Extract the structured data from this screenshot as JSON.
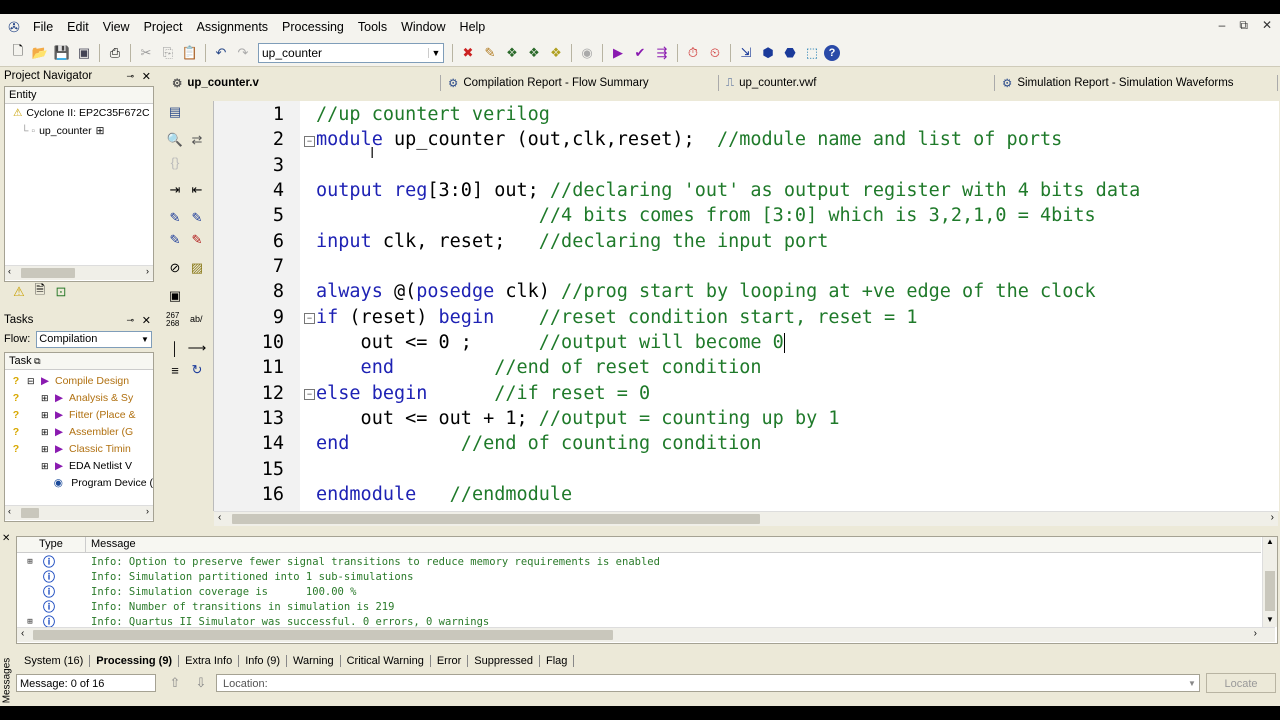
{
  "menu": [
    "File",
    "Edit",
    "View",
    "Project",
    "Assignments",
    "Processing",
    "Tools",
    "Window",
    "Help"
  ],
  "toolbar": {
    "project_combo": "up_counter"
  },
  "project_navigator": {
    "title": "Project Navigator",
    "column": "Entity",
    "device": "Cyclone II: EP2C35F672C",
    "top_entity": "up_counter"
  },
  "tasks": {
    "title": "Tasks",
    "flow_label": "Flow:",
    "flow_value": "Compilation",
    "column": "Task",
    "items": [
      "Compile Design",
      "Analysis & Sy",
      "Fitter (Place &",
      "Assembler (G",
      "Classic Timin",
      "EDA Netlist V",
      "Program Device ("
    ]
  },
  "tabs": [
    "up_counter.v",
    "Compilation Report - Flow Summary",
    "up_counter.vwf",
    "Simulation Report - Simulation Waveforms"
  ],
  "editor": {
    "line_numbers": [
      "1",
      "2",
      "3",
      "4",
      "5",
      "6",
      "7",
      "8",
      "9",
      "10",
      "11",
      "12",
      "13",
      "14",
      "15",
      "16"
    ]
  },
  "messages": {
    "col_type": "Type",
    "col_message": "Message",
    "rows": [
      "Info: Option to preserve fewer signal transitions to reduce memory requirements is enabled",
      "Info: Simulation partitioned into 1 sub-simulations",
      "Info: Simulation coverage is      100.00 %",
      "Info: Number of transitions in simulation is 219",
      "Info: Quartus II Simulator was successful. 0 errors, 0 warnings"
    ],
    "tabs": [
      "System (16)",
      "Processing (9)",
      "Extra Info",
      "Info (9)",
      "Warning",
      "Critical Warning",
      "Error",
      "Suppressed",
      "Flag"
    ],
    "side_label": "Messages",
    "status": "Message: 0 of 16",
    "location_label": "Location:",
    "locate_button": "Locate"
  },
  "colors": {
    "keyword": "#1e22b4",
    "comment": "#1f7a2a",
    "info_text": "#2a7a2a"
  }
}
